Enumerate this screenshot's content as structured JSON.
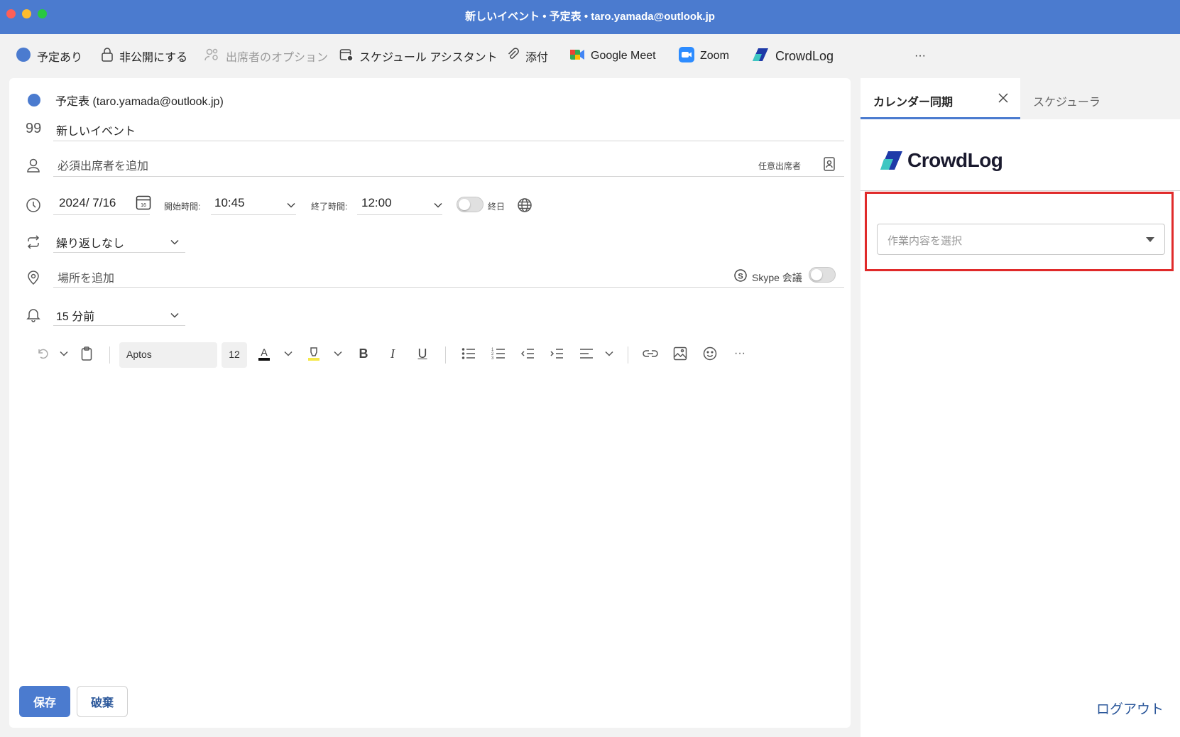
{
  "window": {
    "title": "新しいイベント • 予定表 • taro.yamada@outlook.jp"
  },
  "ribbon": {
    "busy": "予定あり",
    "private": "非公開にする",
    "attendee_options": "出席者のオプション",
    "schedule_assistant": "スケジュール アシスタント",
    "attach": "添付",
    "google_meet": "Google Meet",
    "zoom": "Zoom",
    "crowdlog": "CrowdLog",
    "more": "···"
  },
  "event": {
    "calendar": "予定表 (taro.yamada@outlook.jp)",
    "title": "新しいイベント",
    "required_attendees_placeholder": "必須出席者を追加",
    "optional_attendees": "任意出席者",
    "date": "2024/ 7/16",
    "date_icon_day": "16",
    "start_label": "開始時間:",
    "start_time": "10:45",
    "end_label": "終了時間:",
    "end_time": "12:00",
    "all_day_label": "終日",
    "repeat": "繰り返しなし",
    "location_placeholder": "場所を追加",
    "skype_label": "Skype 会議",
    "reminder": "15 分前"
  },
  "format_toolbar": {
    "font": "Aptos",
    "size": "12",
    "bold": "B",
    "italic": "I",
    "underline": "U",
    "more": "···"
  },
  "actions": {
    "save": "保存",
    "discard": "破棄"
  },
  "side_pane": {
    "active_tab": "カレンダー同期",
    "inactive_tab": "スケジューラ",
    "brand": "CrowdLog",
    "select_placeholder": "作業内容を選択",
    "logout": "ログアウト"
  },
  "colors": {
    "accent": "#4b7bcf",
    "highlight": "#e02a2a",
    "link": "#2b579a"
  }
}
